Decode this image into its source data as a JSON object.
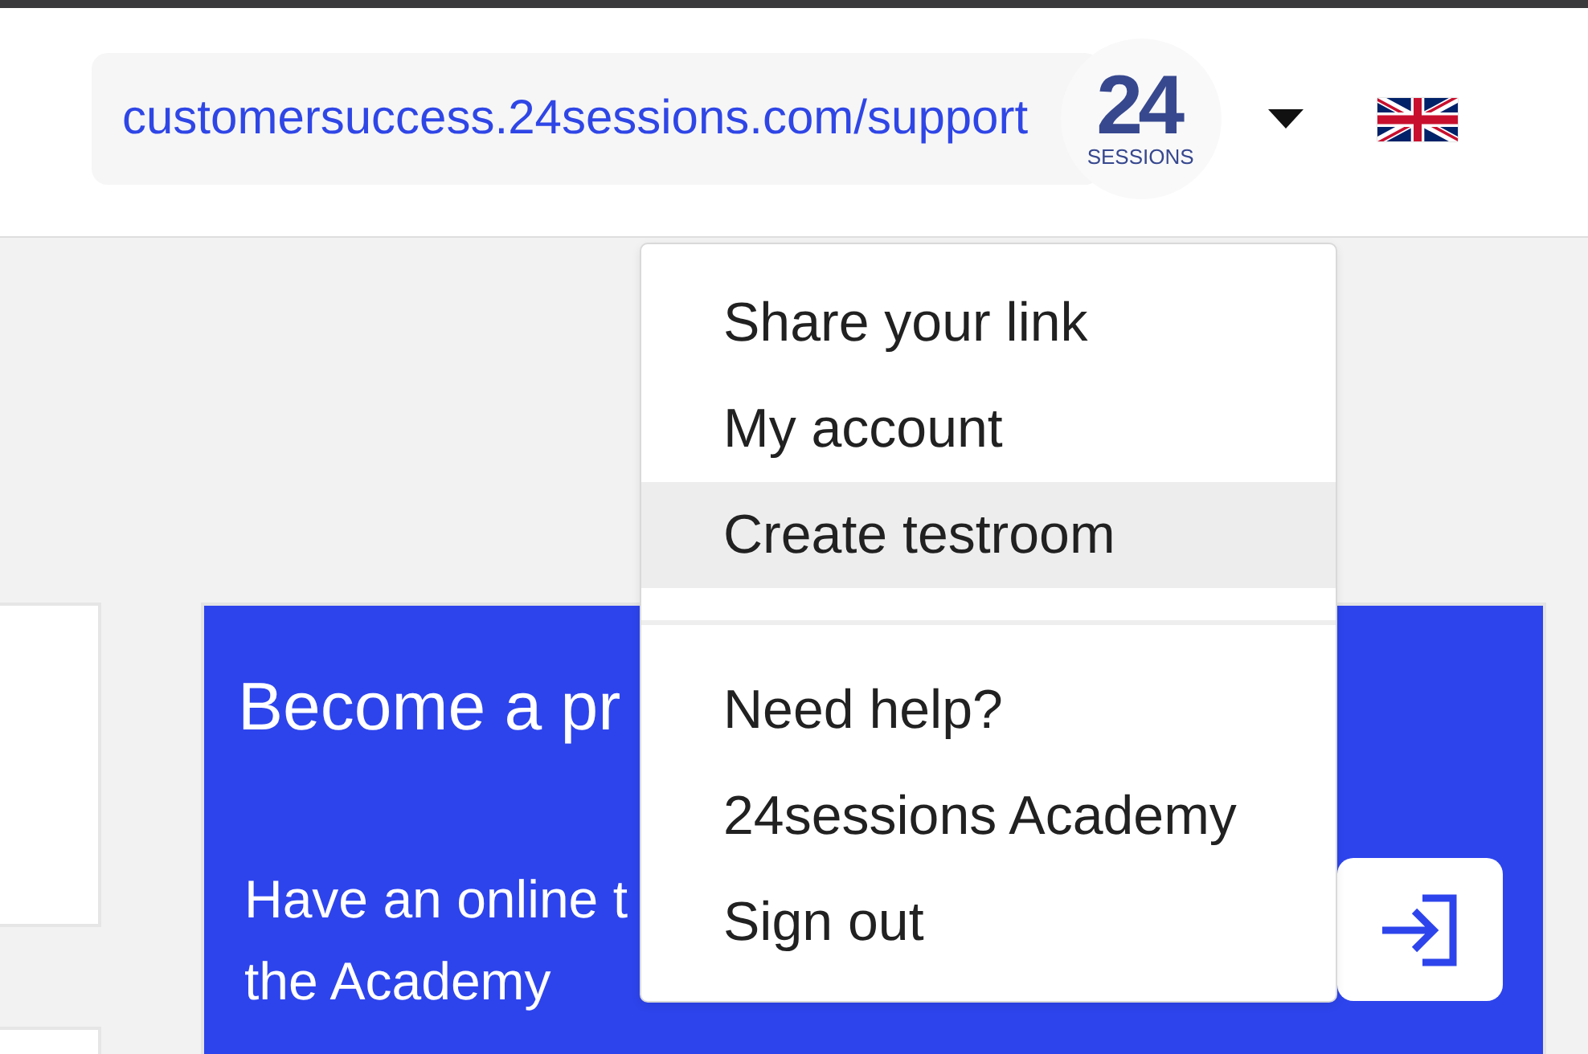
{
  "header": {
    "url": "customersuccess.24sessions.com/support",
    "logo": {
      "number": "24",
      "wordmark": "SESSIONS"
    }
  },
  "account_menu": {
    "expanded": true,
    "sections": [
      {
        "items": [
          {
            "label": "Share your link",
            "selected": false
          },
          {
            "label": "My account",
            "selected": false
          },
          {
            "label": "Create testroom",
            "selected": true
          }
        ]
      },
      {
        "items": [
          {
            "label": "Need help?",
            "selected": false
          },
          {
            "label": "24sessions Academy",
            "selected": false
          },
          {
            "label": "Sign out",
            "selected": false
          }
        ]
      }
    ]
  },
  "promo_card": {
    "title": "Become a pr",
    "description_lines": [
      "Have an online t",
      "the Academy"
    ]
  }
}
